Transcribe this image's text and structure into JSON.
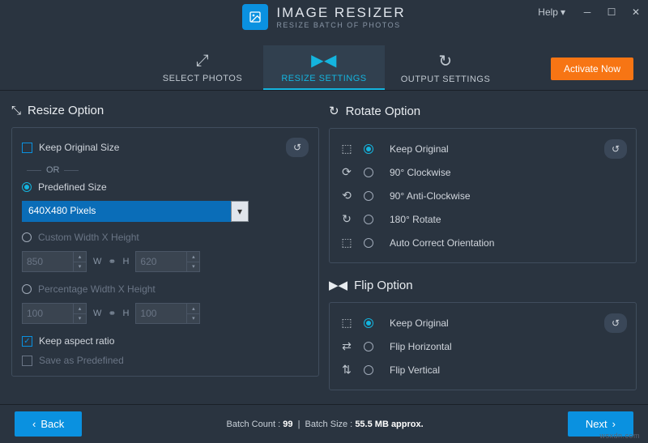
{
  "app": {
    "title": "IMAGE RESIZER",
    "subtitle": "RESIZE BATCH OF PHOTOS"
  },
  "help": "Help",
  "tabs": {
    "select": "SELECT PHOTOS",
    "resize": "RESIZE SETTINGS",
    "output": "OUTPUT SETTINGS"
  },
  "activate": "Activate Now",
  "resize": {
    "title": "Resize Option",
    "keep_original": "Keep Original Size",
    "or": "OR",
    "predefined": "Predefined Size",
    "predefined_value": "640X480 Pixels",
    "custom": "Custom Width X Height",
    "custom_w": "850",
    "custom_h": "620",
    "percent": "Percentage Width X Height",
    "percent_w": "100",
    "percent_h": "100",
    "w_label": "W",
    "h_label": "H",
    "aspect": "Keep aspect ratio",
    "save_predef": "Save as Predefined"
  },
  "rotate": {
    "title": "Rotate Option",
    "opts": [
      "Keep Original",
      "90° Clockwise",
      "90° Anti-Clockwise",
      "180° Rotate",
      "Auto Correct Orientation"
    ]
  },
  "flip": {
    "title": "Flip Option",
    "opts": [
      "Keep Original",
      "Flip Horizontal",
      "Flip Vertical"
    ]
  },
  "footer": {
    "back": "Back",
    "next": "Next",
    "count_label": "Batch Count :",
    "count": "99",
    "size_label": "Batch Size :",
    "size": "55.5 MB approx."
  },
  "watermark": "wsxdn.com"
}
